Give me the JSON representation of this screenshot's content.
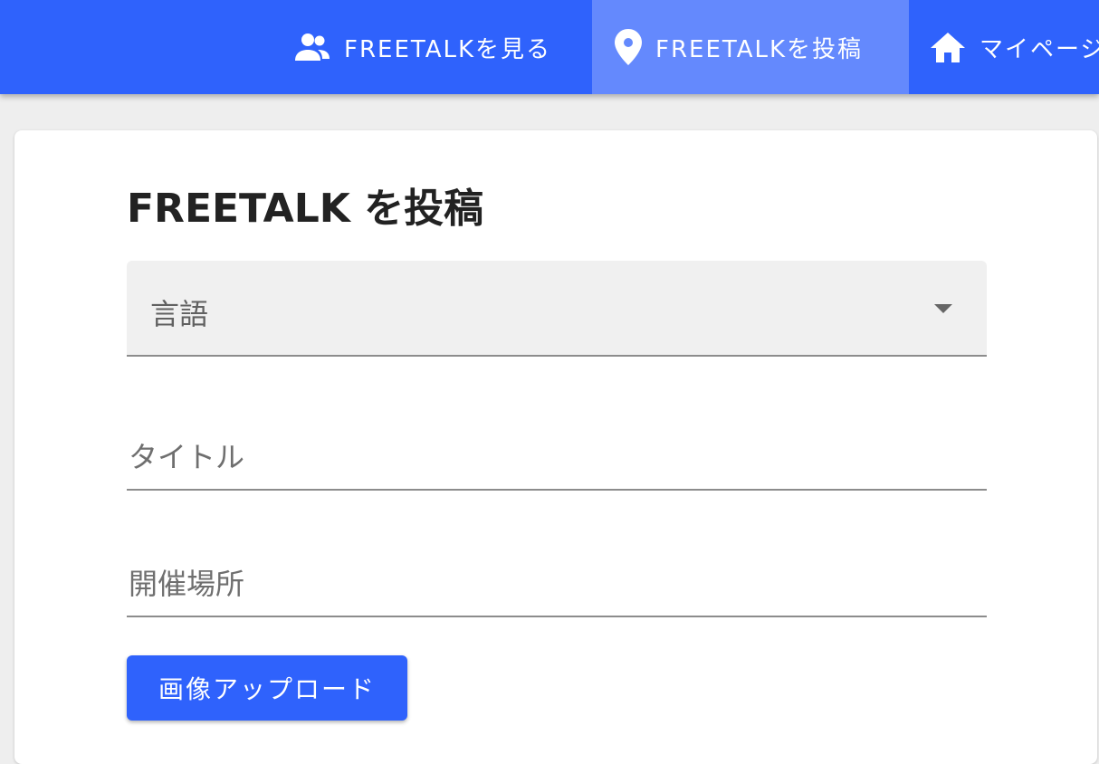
{
  "nav": {
    "tabs": [
      {
        "label": "FREETALKを見る",
        "icon": "people-icon",
        "active": false
      },
      {
        "label": "FREETALKを投稿",
        "icon": "map-pin-icon",
        "active": true
      },
      {
        "label": "マイページ",
        "icon": "home-icon",
        "active": false
      }
    ]
  },
  "page": {
    "title": "FREETALK を投稿"
  },
  "form": {
    "language_select": {
      "label": "言語",
      "value": ""
    },
    "title_field": {
      "label": "タイトル",
      "value": ""
    },
    "place_field": {
      "label": "開催場所",
      "value": ""
    },
    "upload_button_label": "画像アップロード"
  },
  "colors": {
    "primary": "#2f62fc",
    "active_tab": "#6489fd",
    "background": "#eeeeee"
  }
}
